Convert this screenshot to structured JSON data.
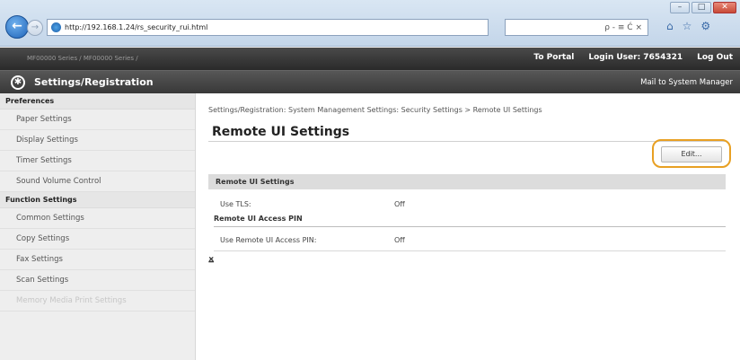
{
  "browser": {
    "url": "http://192.168.1.24/rs_security_rui.html",
    "search_tools": "ρ - ≡ Ć ×",
    "back_icon": "←",
    "forward_icon": "→",
    "home_icon": "⌂",
    "star_icon": "☆",
    "settings_icon": "⚙"
  },
  "topbar": {
    "model_text": "MF00000 Series / MF00000 Series /",
    "to_portal": "To Portal",
    "login_user": "Login User: 7654321",
    "logout": "Log Out"
  },
  "titlebar": {
    "title": "Settings/Registration",
    "mail": "Mail to System Manager"
  },
  "sidebar": {
    "sections": [
      {
        "heading": "Preferences",
        "items": [
          "Paper Settings",
          "Display Settings",
          "Timer Settings",
          "Sound Volume Control"
        ]
      },
      {
        "heading": "Function Settings",
        "items": [
          "Common Settings",
          "Copy Settings",
          "Fax Settings",
          "Scan Settings",
          "Memory Media Print Settings"
        ]
      }
    ]
  },
  "main": {
    "breadcrumb": "Settings/Registration: System Management Settings: Security Settings > Remote UI Settings",
    "page_title": "Remote UI Settings",
    "edit_button": "Edit...",
    "section_title": "Remote UI Settings",
    "use_tls_label": "Use TLS:",
    "use_tls_value": "Off",
    "pin_subheading": "Remote UI Access PIN",
    "use_pin_label": "Use Remote UI Access PIN:",
    "use_pin_value": "Off",
    "top_link": "⨱"
  }
}
